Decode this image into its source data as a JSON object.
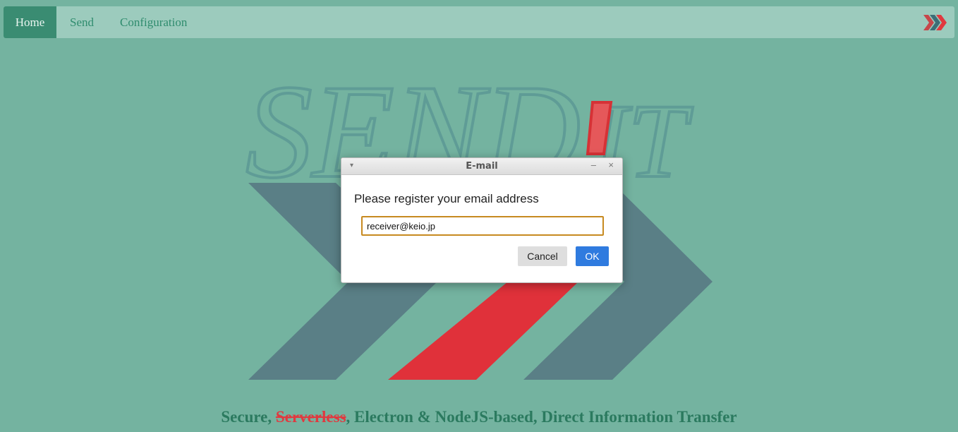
{
  "nav": {
    "items": [
      {
        "label": "Home",
        "active": true
      },
      {
        "label": "Send",
        "active": false
      },
      {
        "label": "Configuration",
        "active": false
      }
    ],
    "brand_icon": "triple-chevron-right-icon"
  },
  "logo": {
    "text_send": "SEND",
    "text_it": "IT",
    "colors": {
      "outline": "#5f9c96",
      "chevron": "#5a7f86",
      "accent": "#e03a3c"
    }
  },
  "tagline": {
    "part1": "Secure, ",
    "strike": "Serverless",
    "part2": ", Electron & NodeJS-based, Direct Information Transfer"
  },
  "dialog": {
    "title": "E-mail",
    "message": "Please register your email address",
    "input_value": "receiver@keio.jp",
    "cancel_label": "Cancel",
    "ok_label": "OK",
    "menu_icon": "▾",
    "minimize_icon": "–",
    "close_icon": "×"
  }
}
